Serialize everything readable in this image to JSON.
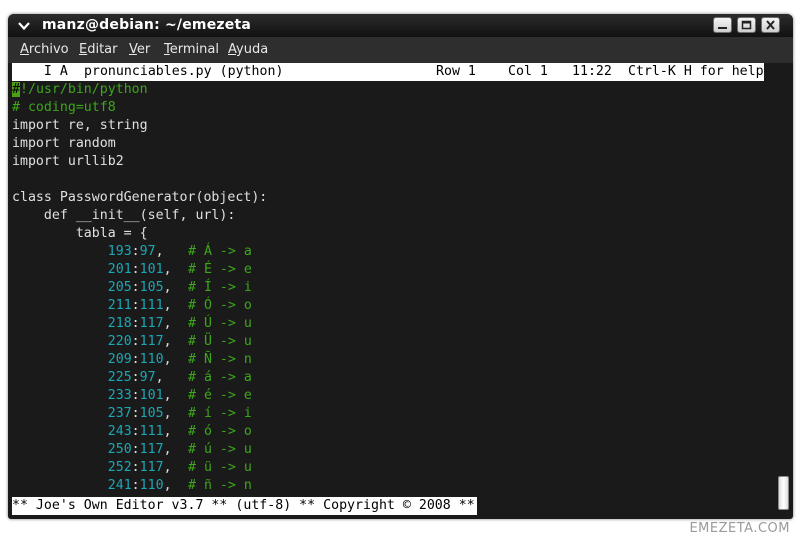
{
  "window": {
    "title": "manz@debian: ~/emezeta",
    "menu": [
      {
        "label": "Archivo",
        "mnemonic": "A",
        "rest": "rchivo"
      },
      {
        "label": "Editar",
        "mnemonic": "E",
        "rest": "ditar"
      },
      {
        "label": "Ver",
        "mnemonic": "V",
        "rest": "er"
      },
      {
        "label": "Terminal",
        "mnemonic": "T",
        "rest": "erminal"
      },
      {
        "label": "Ayuda",
        "mnemonic": "A",
        "rest": "yuda"
      }
    ]
  },
  "editor": {
    "status": {
      "mode": "    I A",
      "filename": "pronunciables.py (python)",
      "row": "Row 1",
      "col": "Col 1",
      "time": "11:22",
      "help": "Ctrl-K H for help"
    },
    "lines": {
      "shebang_cursor": "#",
      "shebang_rest": "!/usr/bin/python",
      "coding": "# coding=utf8",
      "import1": "import re, string",
      "import2": "import random",
      "import3": "import urllib2",
      "class_def": "class PasswordGenerator(object):",
      "def_init": "    def __init__(self, url):",
      "tabla": "        tabla = {"
    },
    "table_entries": [
      {
        "key": "193",
        "val": "97",
        "comment": "# Á -> a"
      },
      {
        "key": "201",
        "val": "101",
        "comment": "# É -> e"
      },
      {
        "key": "205",
        "val": "105",
        "comment": "# Í -> i"
      },
      {
        "key": "211",
        "val": "111",
        "comment": "# Ó -> o"
      },
      {
        "key": "218",
        "val": "117",
        "comment": "# Ú -> u"
      },
      {
        "key": "220",
        "val": "117",
        "comment": "# Ü -> u"
      },
      {
        "key": "209",
        "val": "110",
        "comment": "# Ñ -> n"
      },
      {
        "key": "225",
        "val": "97",
        "comment": "# á -> a"
      },
      {
        "key": "233",
        "val": "101",
        "comment": "# é -> e"
      },
      {
        "key": "237",
        "val": "105",
        "comment": "# í -> i"
      },
      {
        "key": "243",
        "val": "111",
        "comment": "# ó -> o"
      },
      {
        "key": "250",
        "val": "117",
        "comment": "# ú -> u"
      },
      {
        "key": "252",
        "val": "117",
        "comment": "# ü -> u"
      },
      {
        "key": "241",
        "val": "110",
        "comment": "# ñ -> n"
      }
    ],
    "footer": "** Joe's Own Editor v3.7 ** (utf-8) ** Copyright © 2008 **"
  },
  "watermark": "EMEZETA.COM",
  "colors": {
    "comment": "#3da61a",
    "number": "#1aa8b5",
    "background": "#1a1a1a",
    "text": "#e0e0e0"
  },
  "icons": {
    "window_menu": "chevron-down-icon",
    "minimize": "minimize-icon",
    "maximize": "maximize-icon",
    "close": "close-icon"
  }
}
